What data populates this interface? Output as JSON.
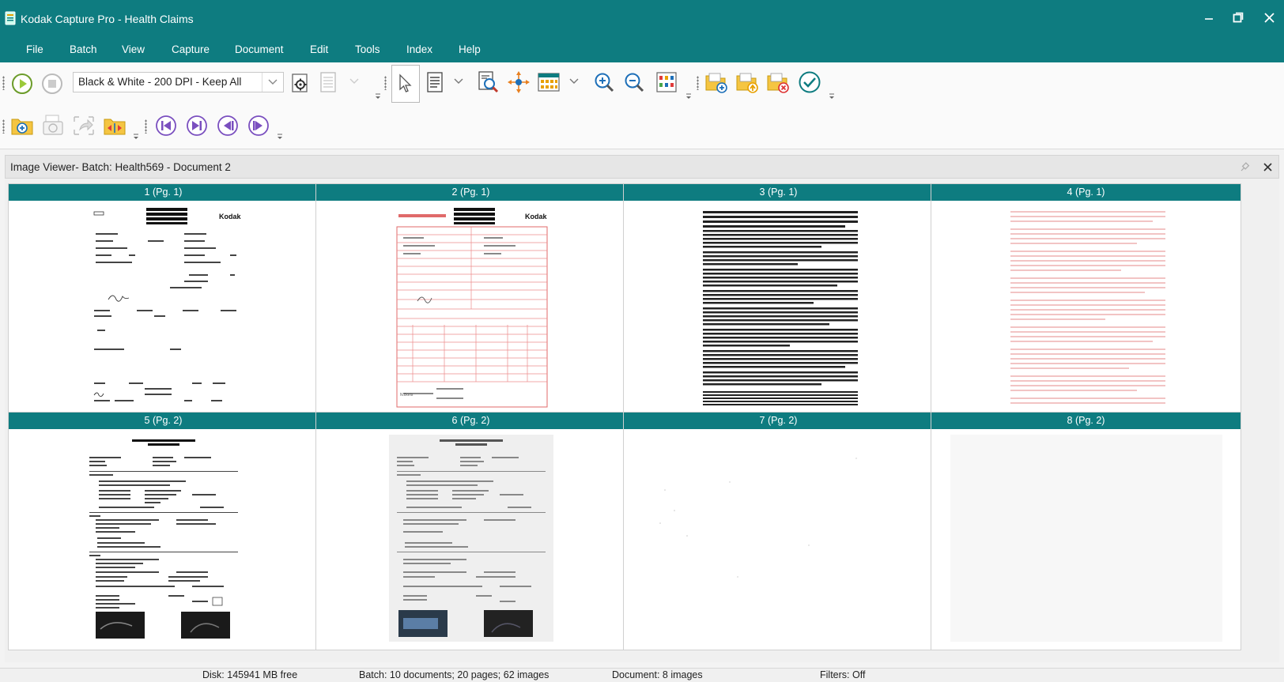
{
  "window": {
    "title": "Kodak Capture Pro - Health Claims",
    "app_icon": "scanner-app-icon",
    "controls": [
      "minimize",
      "restore",
      "close"
    ]
  },
  "menu": [
    "File",
    "Batch",
    "View",
    "Capture",
    "Document",
    "Edit",
    "Tools",
    "Index",
    "Help"
  ],
  "toolbar": {
    "profile_value": "Black & White - 200 DPI - Keep All",
    "accent_color": "#0e7c80"
  },
  "viewer": {
    "title": "Image Viewer- Batch: Health569 - Document 2",
    "thumbnails": [
      {
        "label": "1 (Pg. 1)",
        "kind": "form-bw"
      },
      {
        "label": "2 (Pg. 1)",
        "kind": "form-red"
      },
      {
        "label": "3 (Pg. 1)",
        "kind": "text-dense"
      },
      {
        "label": "4 (Pg. 1)",
        "kind": "text-faint-red"
      },
      {
        "label": "5 (Pg. 2)",
        "kind": "report-bw"
      },
      {
        "label": "6 (Pg. 2)",
        "kind": "report-gray"
      },
      {
        "label": "7 (Pg. 2)",
        "kind": "blank"
      },
      {
        "label": "8 (Pg. 2)",
        "kind": "blank-gray"
      }
    ]
  },
  "status": {
    "disk": "Disk: 145941 MB free",
    "batch": "Batch: 10 documents; 20 pages; 62 images",
    "document": "Document: 8 images",
    "filters": "Filters: Off"
  }
}
